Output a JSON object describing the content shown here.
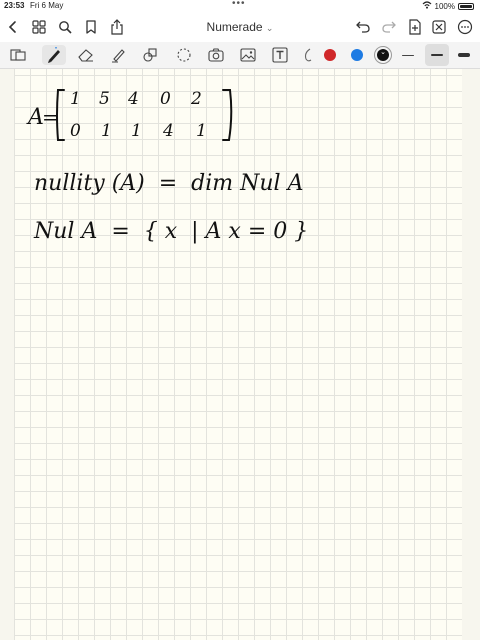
{
  "status": {
    "time": "23:53",
    "date": "Fri 6 May",
    "battery": "100%",
    "battery_level": 1.0
  },
  "app": {
    "title": "Numerade",
    "title_caret": "⌄"
  },
  "toolbar": {
    "tools": [
      "pages-icon",
      "pen-icon",
      "eraser-icon",
      "highlighter-icon",
      "shapes-icon",
      "lasso-icon",
      "image-icon",
      "text-icon",
      "extras-icon"
    ],
    "colors": [
      "#d0282a",
      "#1e7be3",
      "#111111"
    ],
    "selected_color": "#111111"
  },
  "notes": {
    "matrix_name": "A",
    "equals": "=",
    "row1": [
      "1",
      "5",
      "4",
      "0",
      "2"
    ],
    "row2": [
      "0",
      "1",
      "1",
      "4",
      "1"
    ],
    "line2": "nullity (A)  =  dim Nul A",
    "line3": "Nul A  =  { x  | A x = 0 }"
  }
}
